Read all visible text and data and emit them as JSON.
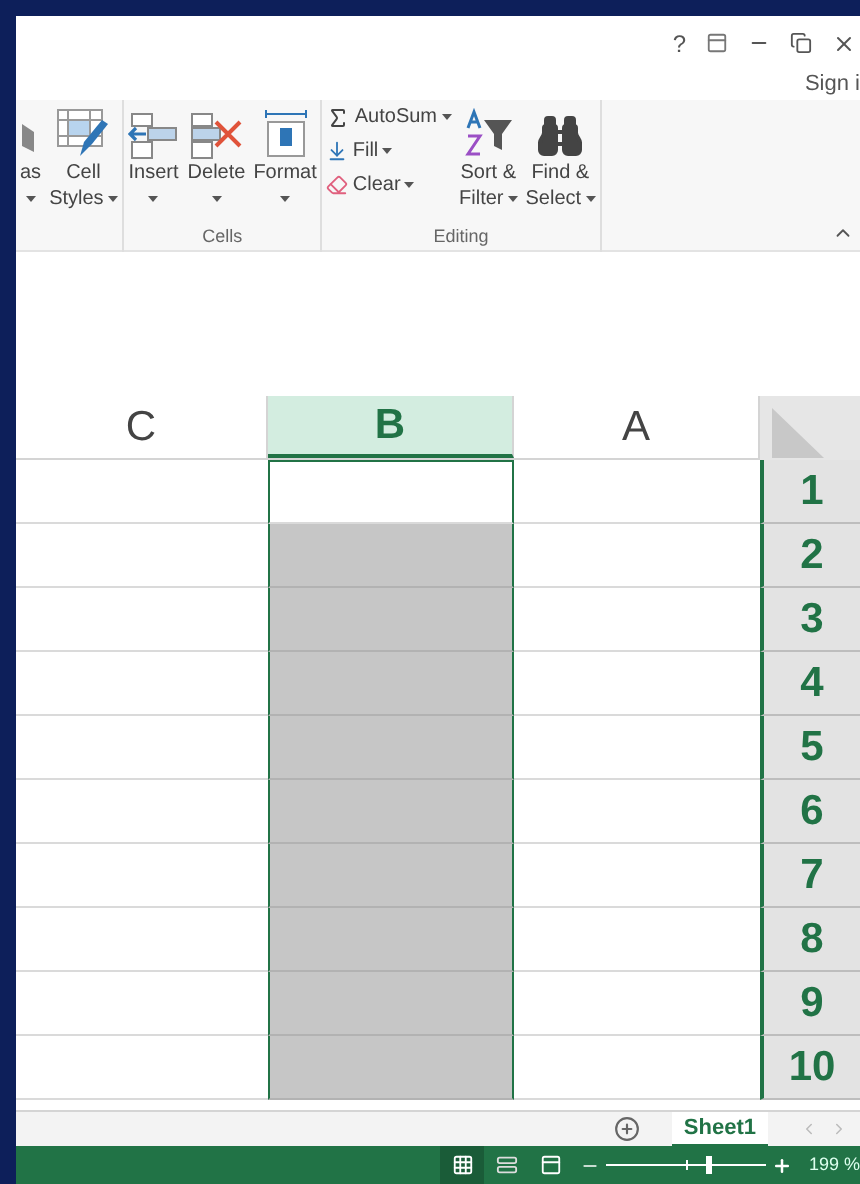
{
  "window": {
    "help": "?",
    "account": "Sign i"
  },
  "ribbon": {
    "groups": [
      {
        "items": [
          {
            "kind": "large",
            "lines": [
              "as"
            ],
            "menu": true
          },
          {
            "kind": "large",
            "lines": [
              "Cell",
              "Styles"
            ],
            "menu": true
          }
        ]
      },
      {
        "label": "Cells",
        "items": [
          {
            "kind": "large",
            "lines": [
              "Insert"
            ],
            "menu": true
          },
          {
            "kind": "large",
            "lines": [
              "Delete"
            ],
            "menu": true
          },
          {
            "kind": "large",
            "lines": [
              "Format"
            ],
            "menu": true
          }
        ]
      },
      {
        "label": "Editing",
        "items": [
          {
            "kind": "stack",
            "entries": [
              {
                "label": "AutoSum",
                "menu": true
              },
              {
                "label": "Fill",
                "menu": true
              },
              {
                "label": "Clear",
                "menu": true
              }
            ]
          },
          {
            "kind": "large",
            "lines": [
              "Sort &",
              "Filter"
            ],
            "menu": true
          },
          {
            "kind": "large",
            "lines": [
              "Find &",
              "Select"
            ],
            "menu": true
          }
        ]
      }
    ]
  },
  "grid": {
    "columns": [
      {
        "label": "C",
        "selected": false,
        "active": false
      },
      {
        "label": "B",
        "selected": true,
        "active": true
      },
      {
        "label": "A",
        "selected": false,
        "active": false
      }
    ],
    "rows": [
      {
        "label": "1",
        "selected": true,
        "active": true
      },
      {
        "label": "2",
        "selected": true,
        "active": false
      },
      {
        "label": "3",
        "selected": true,
        "active": false
      },
      {
        "label": "4",
        "selected": true,
        "active": false
      },
      {
        "label": "5",
        "selected": true,
        "active": false
      },
      {
        "label": "6",
        "selected": true,
        "active": false
      },
      {
        "label": "7",
        "selected": true,
        "active": false
      },
      {
        "label": "8",
        "selected": true,
        "active": false
      },
      {
        "label": "9",
        "selected": true,
        "active": false
      },
      {
        "label": "10",
        "selected": true,
        "active": false
      }
    ]
  },
  "sheet_tabs": [
    {
      "label": "Sheet1",
      "selected": true
    }
  ],
  "status_bar": {
    "views": [
      {
        "selected": true
      },
      {
        "selected": false
      },
      {
        "selected": false
      }
    ],
    "zoom": {
      "level": 0.63,
      "reading": "199 %"
    }
  }
}
